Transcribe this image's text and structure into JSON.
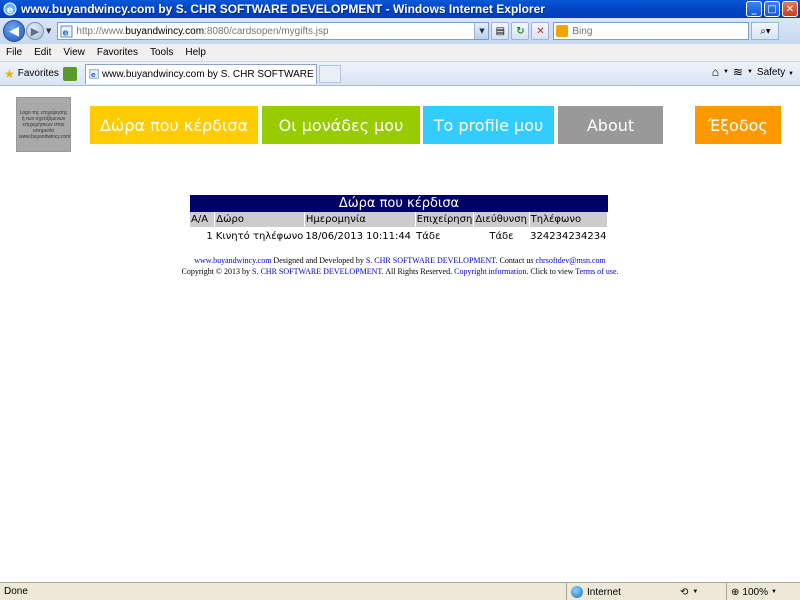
{
  "window": {
    "title": "www.buyandwincy.com by S. CHR SOFTWARE DEVELOPMENT - Windows Internet Explorer",
    "controls": {
      "minimize": "_",
      "maximize": "□",
      "close": "✕"
    }
  },
  "address": {
    "url_prefix": "http://www.",
    "url_domain": "buyandwincy.com",
    "url_rest": ":8080/cardsopen/mygifts.jsp",
    "search_placeholder": "Bing"
  },
  "menu": [
    "File",
    "Edit",
    "View",
    "Favorites",
    "Tools",
    "Help"
  ],
  "favorites": {
    "label": "Favorites",
    "tab_title": "www.buyandwincy.com by S. CHR SOFTWARE DEVEL...",
    "safety_label": "Safety"
  },
  "page": {
    "logo_text": "Logo της επιχείρησης ή των σχετιζόμενων επιχειρήσεων στην υπηρεσία www.buyandwincy.com",
    "nav": [
      {
        "label": "Δώρα που κέρδισα",
        "color": "#ffcc00",
        "text_color": "#ffffff"
      },
      {
        "label": "Οι μονάδες μου",
        "color": "#99cc00",
        "text_color": "#ffffff"
      },
      {
        "label": "Το profile μου",
        "color": "#33ccff",
        "text_color": "#ffffff"
      },
      {
        "label": "About",
        "color": "#999999",
        "text_color": "#ffffff"
      },
      {
        "label": "Έξοδος",
        "color": "#ff9900",
        "text_color": "#ffffff"
      }
    ],
    "gifts_table": {
      "caption": "Δώρα που κέρδισα",
      "headers": [
        "Α/Α",
        "Δώρο",
        "Ημερομηνία",
        "Επιχείρηση",
        "Διεύθυνση",
        "Τηλέφωνο"
      ],
      "rows": [
        [
          "1",
          "Κινητό τηλέφωνο",
          "18/06/2013 10:11:44",
          "Τάδε",
          "Τάδε",
          "324234234234"
        ]
      ]
    },
    "footer": {
      "site_link": "www.buyandwincy.com",
      "designed_text": " Designed and Developed by ",
      "company_link": "S. CHR SOFTWARE DEVELOPMENT",
      "contact_text": ". Contact us ",
      "email_link": "chrsoftdev@msn.com",
      "copyright_text": "Copyright © 2013 by ",
      "company_link2": "S. CHR SOFTWARE DEVELOPMENT",
      "rights_text": ". All Rights Reserved. ",
      "copyright_link": "Copyright information",
      "terms_text": ". Click to view ",
      "terms_link": "Terms of use",
      "end_text": "."
    }
  },
  "status": {
    "text": "Done",
    "zone": "Internet",
    "zoom": "100%"
  }
}
